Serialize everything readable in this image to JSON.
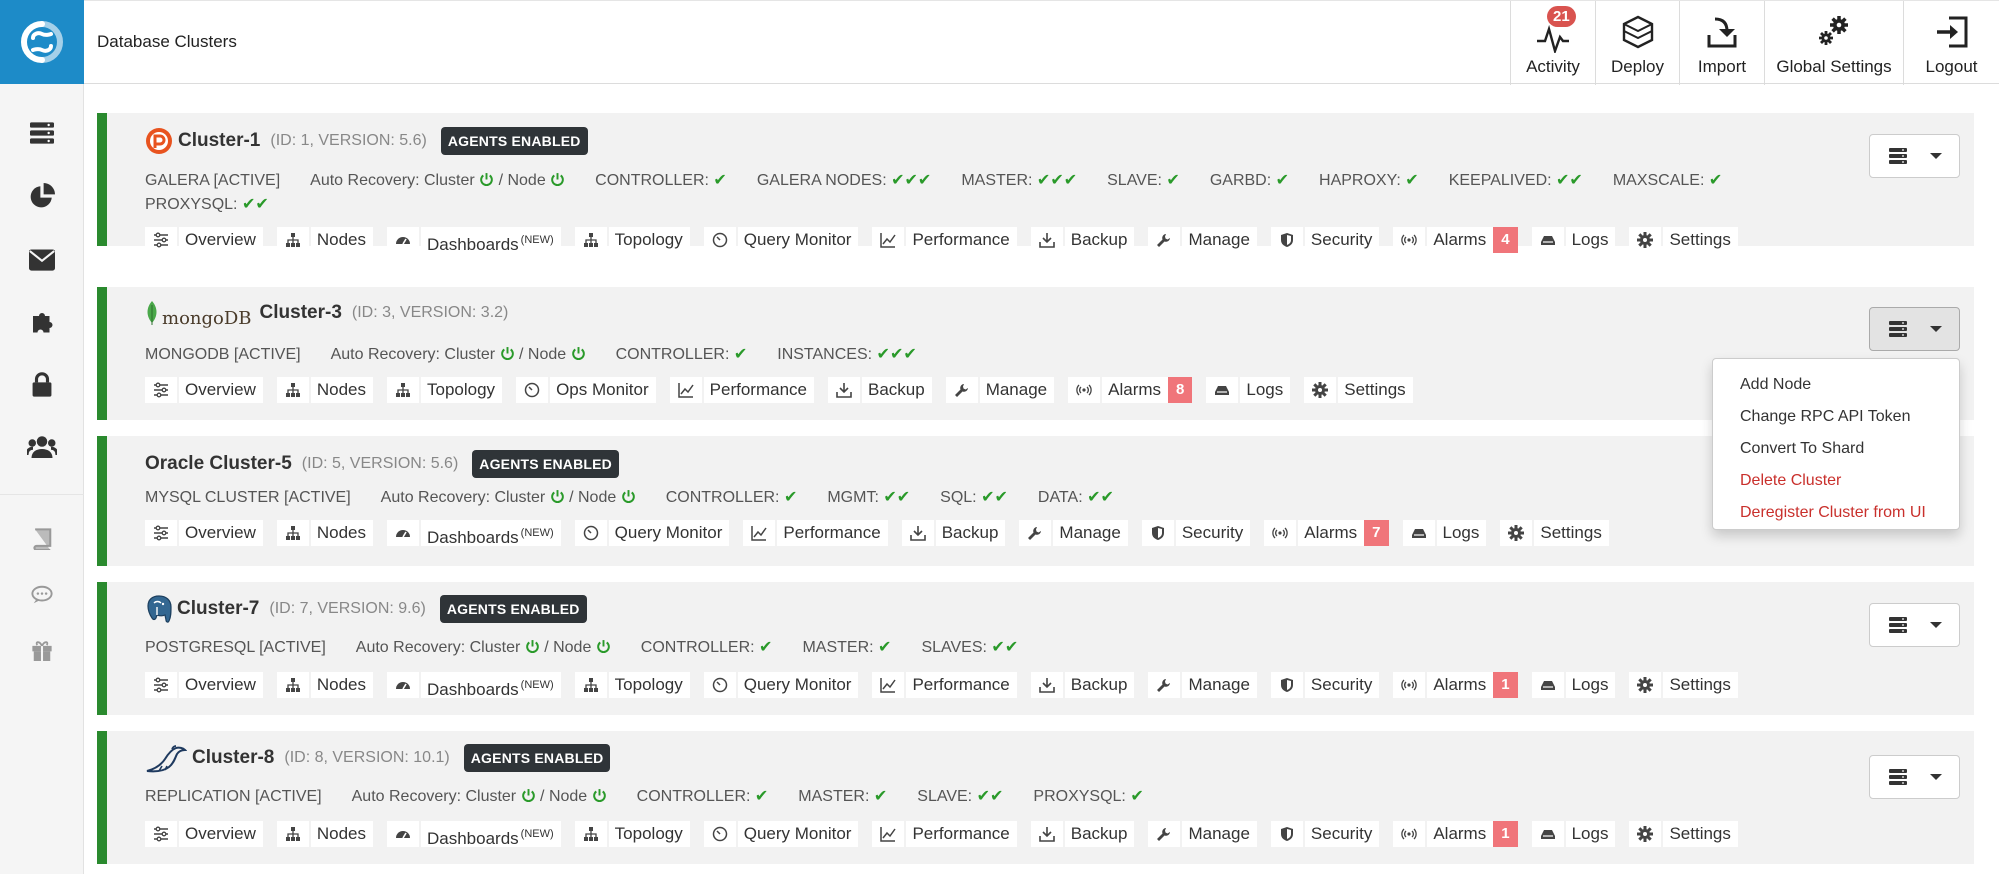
{
  "app": {
    "title": "Database Clusters"
  },
  "topbar": {
    "activity": {
      "label": "Activity",
      "count": "21"
    },
    "deploy": {
      "label": "Deploy"
    },
    "import": {
      "label": "Import"
    },
    "global_settings": {
      "label": "Global Settings"
    },
    "logout": {
      "label": "Logout"
    }
  },
  "sidebar": {
    "items": [
      {
        "icon": "database-icon"
      },
      {
        "icon": "pie-chart-icon"
      },
      {
        "icon": "envelope-icon"
      },
      {
        "icon": "puzzle-icon"
      },
      {
        "icon": "lock-icon"
      },
      {
        "icon": "users-icon"
      },
      {
        "icon": "book-icon"
      },
      {
        "icon": "chat-icon"
      },
      {
        "icon": "gift-icon"
      }
    ]
  },
  "common": {
    "overview": "Overview",
    "nodes": "Nodes",
    "dashboards": "Dashboards",
    "new": "(NEW)",
    "topology": "Topology",
    "query_monitor": "Query Monitor",
    "ops_monitor": "Ops Monitor",
    "performance": "Performance",
    "backup": "Backup",
    "manage": "Manage",
    "security": "Security",
    "alarms": "Alarms",
    "logs": "Logs",
    "settings": "Settings",
    "agents_enabled": "AGENTS ENABLED",
    "auto_recovery": "Auto Recovery: Cluster",
    "node": "/ Node"
  },
  "clusters": [
    {
      "name": "Cluster-1",
      "meta": "(ID: 1, VERSION: 5.6)",
      "type": "GALERA [ACTIVE]",
      "components": [
        {
          "label": "CONTROLLER:",
          "checks": "✔"
        },
        {
          "label": "GALERA NODES:",
          "checks": "✔✔✔"
        },
        {
          "label": "MASTER:",
          "checks": "✔✔✔"
        },
        {
          "label": "SLAVE:",
          "checks": "✔"
        },
        {
          "label": "GARBD:",
          "checks": "✔"
        },
        {
          "label": "HAPROXY:",
          "checks": "✔"
        },
        {
          "label": "KEEPALIVED:",
          "checks": "✔✔"
        },
        {
          "label": "MAXSCALE:",
          "checks": "✔"
        },
        {
          "label": "PROXYSQL:",
          "checks": "✔✔"
        }
      ],
      "alarms": "4"
    },
    {
      "name": "Cluster-3",
      "meta": "(ID: 3, VERSION: 3.2)",
      "type": "MONGODB [ACTIVE]",
      "logo_text": "mongoDB",
      "components": [
        {
          "label": "CONTROLLER:",
          "checks": "✔"
        },
        {
          "label": "INSTANCES:",
          "checks": "✔✔✔"
        }
      ],
      "alarms": "8"
    },
    {
      "name": "Oracle Cluster-5",
      "meta": "(ID: 5, VERSION: 5.6)",
      "type": "MYSQL CLUSTER [ACTIVE]",
      "components": [
        {
          "label": "CONTROLLER:",
          "checks": "✔"
        },
        {
          "label": "MGMT:",
          "checks": "✔✔"
        },
        {
          "label": "SQL:",
          "checks": "✔✔"
        },
        {
          "label": "DATA:",
          "checks": "✔✔"
        }
      ],
      "alarms": "7"
    },
    {
      "name": "Cluster-7",
      "meta": "(ID: 7, VERSION: 9.6)",
      "type": "POSTGRESQL [ACTIVE]",
      "components": [
        {
          "label": "CONTROLLER:",
          "checks": "✔"
        },
        {
          "label": "MASTER:",
          "checks": "✔"
        },
        {
          "label": "SLAVES:",
          "checks": "✔✔"
        }
      ],
      "alarms": "1"
    },
    {
      "name": "Cluster-8",
      "meta": "(ID: 8, VERSION: 10.1)",
      "type": "REPLICATION [ACTIVE]",
      "components": [
        {
          "label": "CONTROLLER:",
          "checks": "✔"
        },
        {
          "label": "MASTER:",
          "checks": "✔"
        },
        {
          "label": "SLAVE:",
          "checks": "✔✔"
        },
        {
          "label": "PROXYSQL:",
          "checks": "✔"
        }
      ],
      "alarms": "1"
    }
  ],
  "dropdown": {
    "items": [
      "Add Node",
      "Change RPC API Token",
      "Convert To Shard",
      "Delete Cluster",
      "Deregister Cluster from UI"
    ]
  },
  "colors": {
    "accent": "#1d8bc8",
    "active_bar": "#2a8a2e",
    "alarm": "#f0757a",
    "danger": "#c9302c",
    "ok": "#2a9a2a"
  }
}
